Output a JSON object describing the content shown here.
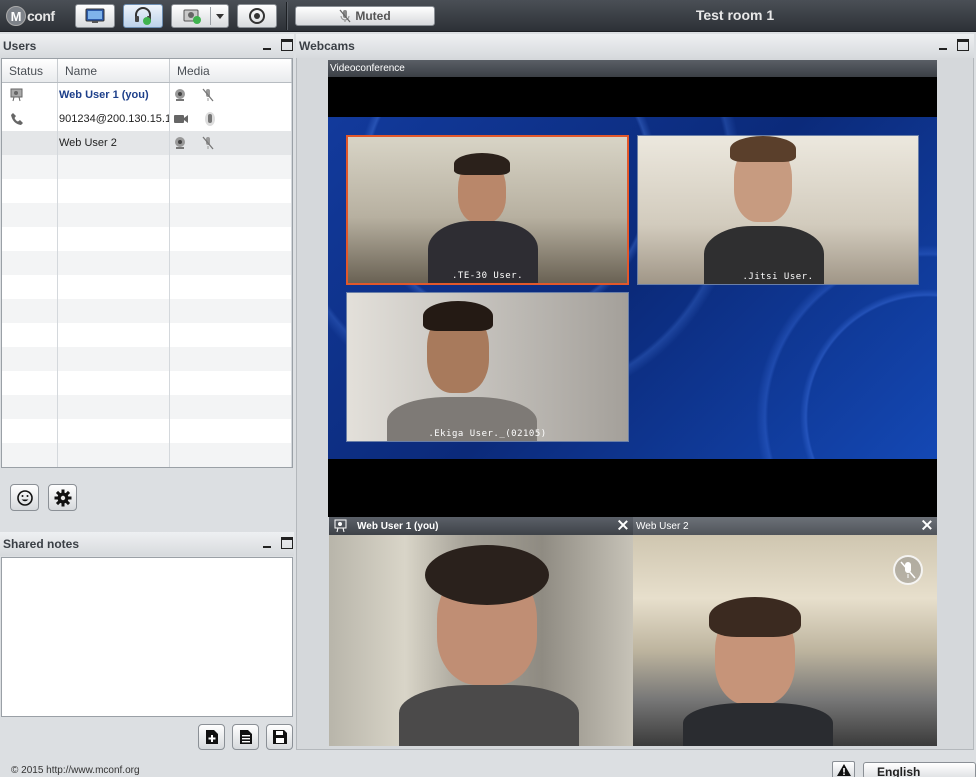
{
  "app": {
    "logo_text": "conf",
    "logo_mark": "M"
  },
  "toolbar": {
    "muted_label": "Muted",
    "room_title": "Test room 1"
  },
  "users": {
    "title": "Users",
    "columns": [
      "Status",
      "Name",
      "Media"
    ],
    "rows": [
      {
        "name": "Web User 1 (you)",
        "status_icon": "presenter-icon",
        "media": [
          "webcam-icon",
          "mic-muted-icon"
        ]
      },
      {
        "name": "901234@200.130.15.1",
        "status_icon": "phone-icon",
        "media": [
          "video-camera-icon",
          "mic-icon"
        ]
      },
      {
        "name": "Web User 2",
        "status_icon": "",
        "media": [
          "webcam-icon",
          "mic-muted-icon"
        ]
      }
    ]
  },
  "shared_notes": {
    "title": "Shared notes",
    "content": ""
  },
  "webcams": {
    "title": "Webcams",
    "videoconference": {
      "title": "Videoconference",
      "tiles": [
        ".TE-30 User.",
        ".Jitsi User.",
        ".Ekiga User._(02105)"
      ]
    },
    "cams": [
      {
        "name": "Web User 1 (you)"
      },
      {
        "name": "Web User 2"
      }
    ]
  },
  "footer": {
    "copyright": "© 2015 http://www.mconf.org",
    "language": "English"
  }
}
